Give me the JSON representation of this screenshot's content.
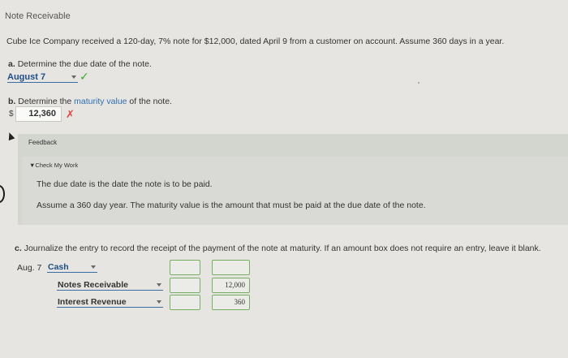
{
  "title": "Note Receivable",
  "intro": "Cube Ice Company received a 120-day, 7% note for $12,000, dated April 9 from a customer on account. Assume 360 days in a year.",
  "part_a": {
    "letter": "a.",
    "prompt": "Determine the due date of the note.",
    "answer": "August 7",
    "status_mark": "✓"
  },
  "part_b": {
    "letter": "b.",
    "prompt_pre": "Determine the",
    "prompt_link": "maturity value",
    "prompt_post": "of the note.",
    "currency": "$",
    "answer": "12,360",
    "status_mark": "✗"
  },
  "feedback": {
    "title": "Feedback",
    "toggle_label": "▼Check My Work",
    "line1": "The due date is the date the note is to be paid.",
    "line2": "Assume a 360 day year. The maturity value is the amount that must be paid at the due date of the note."
  },
  "part_c": {
    "letter": "c.",
    "prompt": "Journalize the entry to record the receipt of the payment of the note at maturity. If an amount box does not require an entry, leave it blank.",
    "date_label": "Aug. 7",
    "rows": [
      {
        "account": "Cash",
        "debit": "",
        "credit": ""
      },
      {
        "account": "Notes Receivable",
        "debit": "",
        "credit": "12,000"
      },
      {
        "account": "Interest Revenue",
        "debit": "",
        "credit": "360"
      }
    ]
  },
  "colors": {
    "check": "#3fa534",
    "cross": "#e14545",
    "link": "#1f4d86"
  }
}
